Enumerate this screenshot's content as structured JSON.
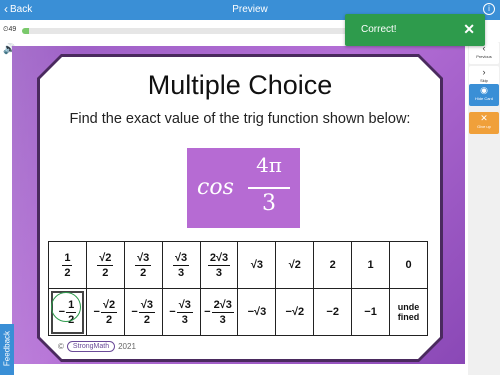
{
  "header": {
    "back_label": "Back",
    "title": "Preview"
  },
  "progress": {
    "timer": "49",
    "fraction": 0.02
  },
  "toast": {
    "message": "Correct!",
    "close": "✕"
  },
  "right_panel": {
    "previous": "Previous",
    "skip": "Skip",
    "hide_card": "Hide Card",
    "give_up": "Give up"
  },
  "slide": {
    "title": "Multiple Choice",
    "prompt": "Find the exact value of the trig function shown below:",
    "question": {
      "func": "cos",
      "numerator": "4π",
      "denominator": "3"
    },
    "answers_top": [
      {
        "neg": false,
        "num": "1",
        "den": "2"
      },
      {
        "neg": false,
        "num": "√2",
        "den": "2"
      },
      {
        "neg": false,
        "num": "√3",
        "den": "2"
      },
      {
        "neg": false,
        "num": "√3",
        "den": "3"
      },
      {
        "neg": false,
        "num": "2√3",
        "den": "3"
      },
      {
        "neg": false,
        "text": "√3"
      },
      {
        "neg": false,
        "text": "√2"
      },
      {
        "neg": false,
        "text": "2"
      },
      {
        "neg": false,
        "text": "1"
      },
      {
        "neg": false,
        "text": "0"
      }
    ],
    "answers_bottom": [
      {
        "neg": true,
        "num": "1",
        "den": "2",
        "selected": true
      },
      {
        "neg": true,
        "num": "√2",
        "den": "2"
      },
      {
        "neg": true,
        "num": "√3",
        "den": "2"
      },
      {
        "neg": true,
        "num": "√3",
        "den": "3"
      },
      {
        "neg": true,
        "num": "2√3",
        "den": "3"
      },
      {
        "neg": false,
        "text": "−√3"
      },
      {
        "neg": false,
        "text": "−√2"
      },
      {
        "neg": false,
        "text": "−2"
      },
      {
        "neg": false,
        "text": "−1"
      },
      {
        "neg": false,
        "text": "unde fined"
      }
    ],
    "footer_copyright": "©",
    "footer_logo": "StrongMath",
    "footer_year": "2021"
  },
  "feedback": "Feedback",
  "colors": {
    "topbar": "#3a8fd6",
    "toast": "#2e9b4c",
    "slide_bg": "#9a5dc4",
    "question_box": "#b66bd3"
  },
  "icons": {
    "back": "chevron-left-icon",
    "info": "info-icon",
    "speaker": "speaker-icon"
  }
}
